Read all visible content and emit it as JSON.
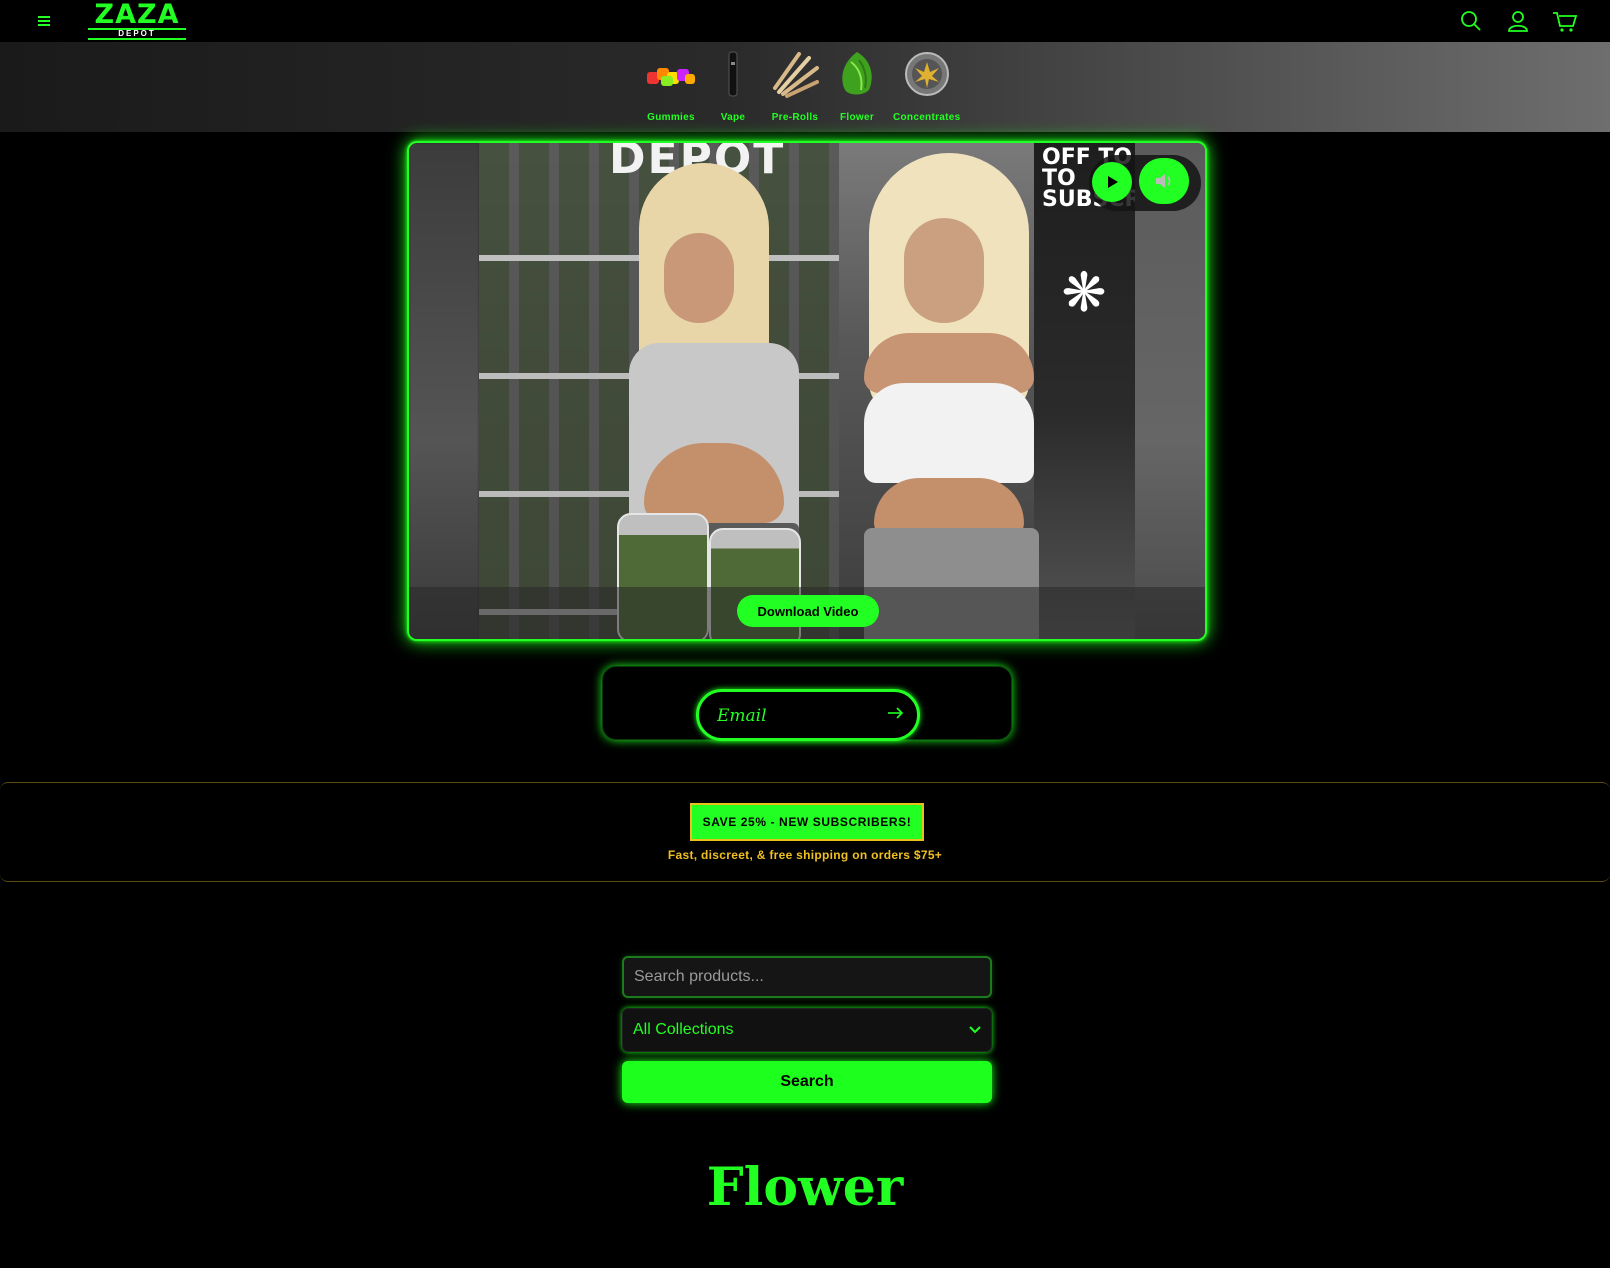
{
  "header": {
    "logo_text": "ZAZA",
    "logo_sub": "DEPOT",
    "menu_icon": "hamburger-icon",
    "icons": [
      "search-icon",
      "account-icon",
      "cart-icon"
    ]
  },
  "categories": [
    {
      "label": "Gummies",
      "icon": "gummies-icon"
    },
    {
      "label": "Vape",
      "icon": "vape-icon"
    },
    {
      "label": "Pre-Rolls",
      "icon": "prerolls-icon"
    },
    {
      "label": "Flower",
      "icon": "flower-icon"
    },
    {
      "label": "Concentrates",
      "icon": "concentrates-icon"
    }
  ],
  "video": {
    "store_sign": "DEPOT",
    "panel_text": "OFF TO N\nTO\nSUBSCRI",
    "download_label": "Download Video",
    "play_icon": "play-icon",
    "sound_icon": "speaker-icon"
  },
  "email": {
    "placeholder": "Email",
    "submit_icon": "arrow-right-icon"
  },
  "promo": {
    "badge": "SAVE 25% - NEW SUBSCRIBERS!",
    "subtext": "Fast, discreet, & free shipping on orders $75+"
  },
  "search": {
    "placeholder": "Search products...",
    "selected_collection": "All Collections",
    "button_label": "Search"
  },
  "page_title": "Flower",
  "colors": {
    "accent": "#22ff22",
    "background": "#000000",
    "promo_text": "#f0c020"
  }
}
